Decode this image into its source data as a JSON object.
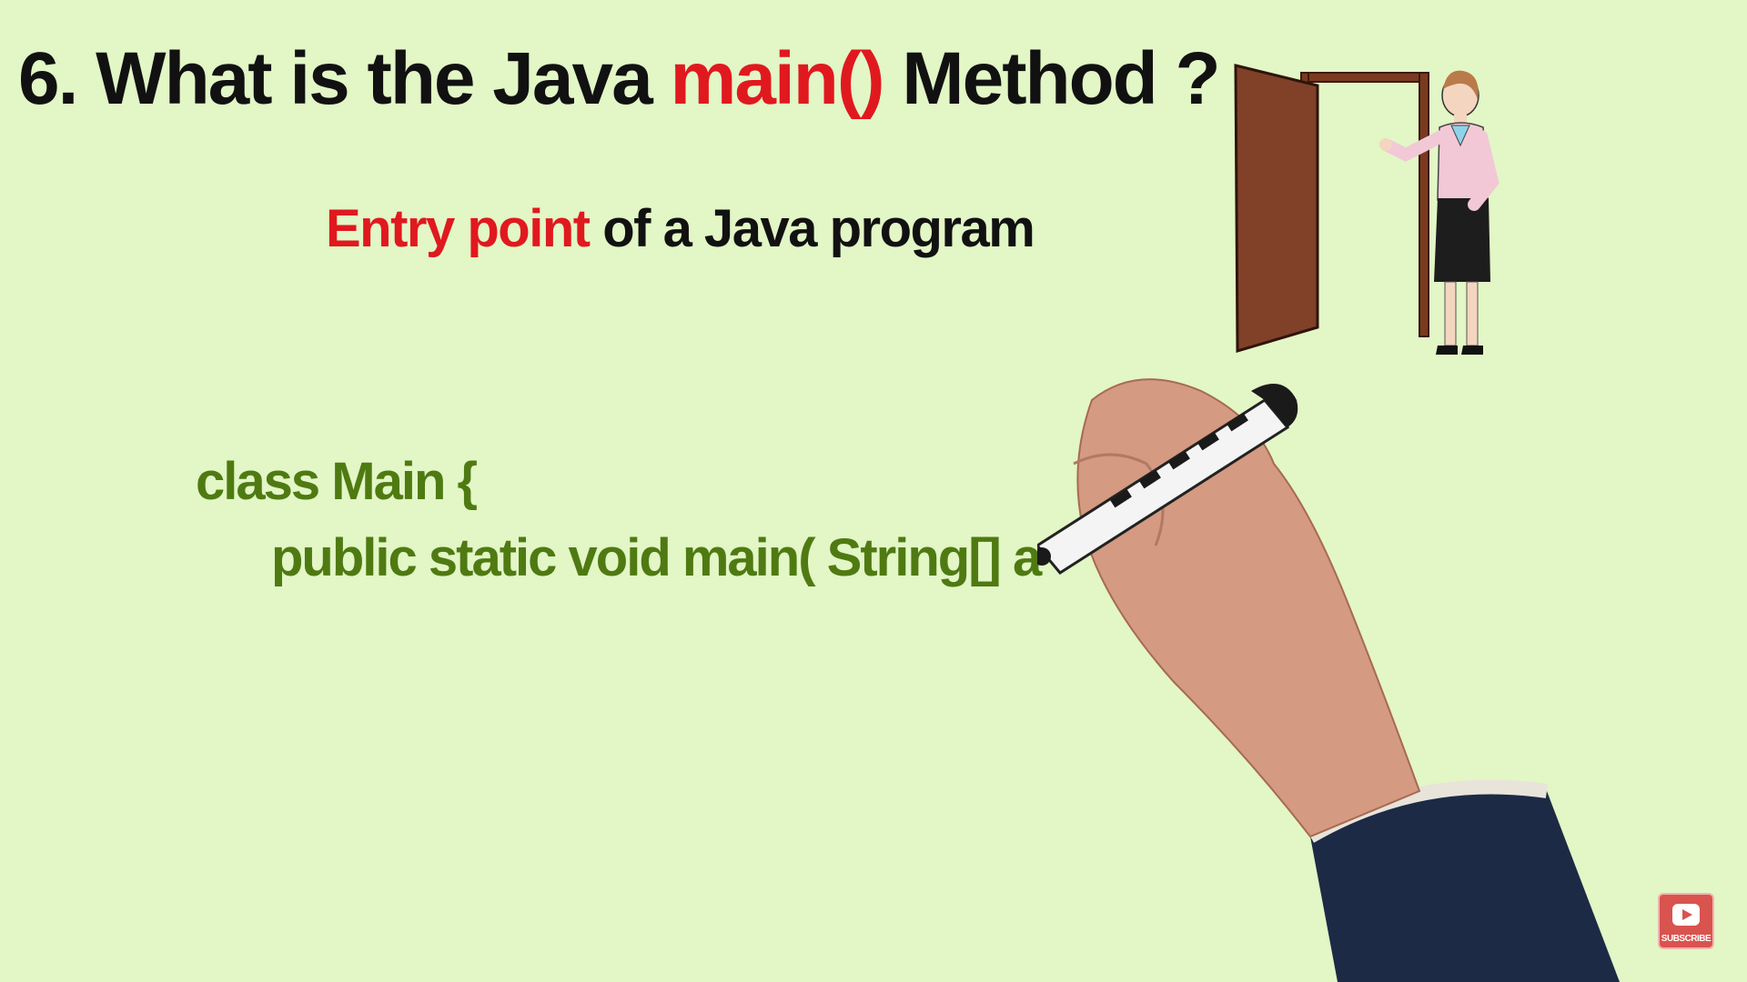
{
  "title": {
    "prefix": "6. What is the Java ",
    "highlight": "main()",
    "suffix": " Method ?"
  },
  "subtitle": {
    "highlight": "Entry point",
    "rest": " of a Java program"
  },
  "code": {
    "line1": "class Main {",
    "line2": "public static void main( String[] a"
  },
  "subscribe": {
    "label": "SUBSCRIBE",
    "icon": "youtube-play-icon"
  },
  "colors": {
    "background": "#e2f6c6",
    "accent": "#e0191f",
    "code": "#4f7a12",
    "text": "#111111"
  }
}
